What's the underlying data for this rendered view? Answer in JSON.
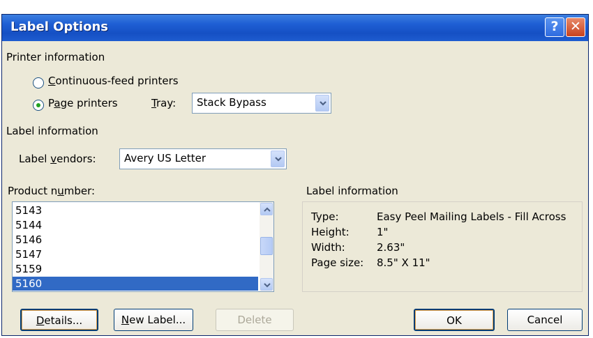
{
  "window": {
    "title": "Label Options",
    "help_glyph": "?",
    "close_glyph": "✕"
  },
  "printer": {
    "section_label": "Printer information",
    "continuous": {
      "pre": "",
      "mnemonic": "C",
      "post": "ontinuous-feed printers",
      "selected": false
    },
    "page": {
      "pre": "P",
      "mnemonic": "a",
      "post": "ge printers",
      "selected": true
    },
    "tray": {
      "pre": "",
      "mnemonic": "T",
      "post": "ray:",
      "value": "Stack Bypass"
    }
  },
  "label_info": {
    "section_label": "Label information",
    "vendors": {
      "pre": "Label ",
      "mnemonic": "v",
      "post": "endors:",
      "value": "Avery US Letter"
    }
  },
  "product": {
    "pre": "Product n",
    "mnemonic": "u",
    "post": "mber:",
    "items": [
      "5143",
      "5144",
      "5146",
      "5147",
      "5159",
      "5160"
    ],
    "selected_index": 5
  },
  "details": {
    "section_label": "Label information",
    "rows": [
      {
        "key": "Type:",
        "value": "Easy Peel Mailing Labels - Fill Across"
      },
      {
        "key": "Height:",
        "value": "1\""
      },
      {
        "key": "Width:",
        "value": "2.63\""
      },
      {
        "key": "Page size:",
        "value": "8.5\" X 11\""
      }
    ]
  },
  "buttons": {
    "details": {
      "mnemonic": "D",
      "post": "etails..."
    },
    "new_label": {
      "mnemonic": "N",
      "post": "ew Label..."
    },
    "delete": "Delete",
    "ok": "OK",
    "cancel": "Cancel"
  }
}
